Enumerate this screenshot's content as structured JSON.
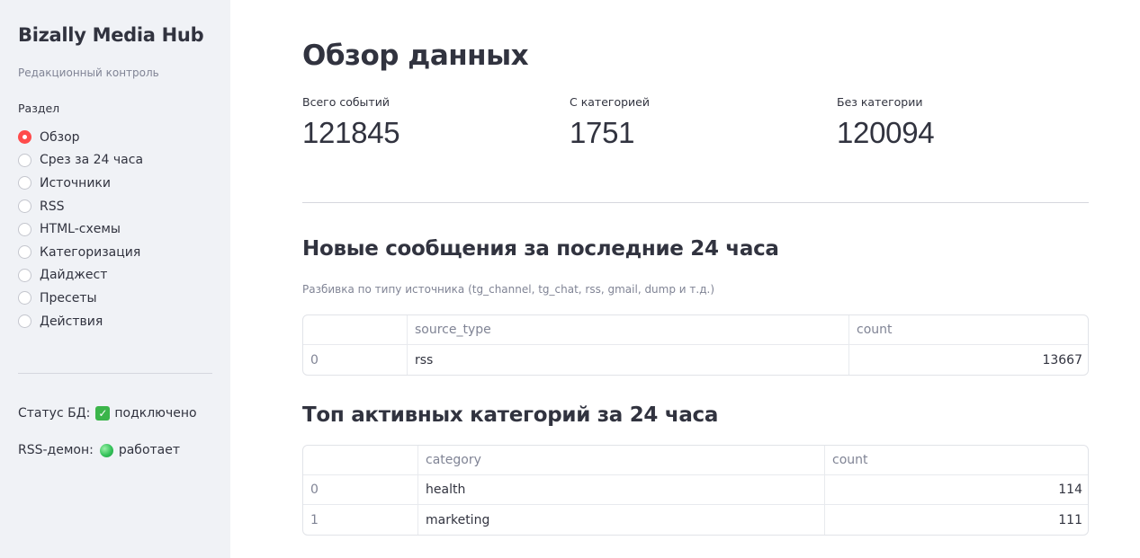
{
  "sidebar": {
    "title": "Bizally Media Hub",
    "caption": "Редакционный контроль",
    "nav_label": "Раздел",
    "items": [
      {
        "label": "Обзор",
        "selected": true
      },
      {
        "label": "Срез за 24 часа",
        "selected": false
      },
      {
        "label": "Источники",
        "selected": false
      },
      {
        "label": "RSS",
        "selected": false
      },
      {
        "label": "HTML-схемы",
        "selected": false
      },
      {
        "label": "Категоризация",
        "selected": false
      },
      {
        "label": "Дайджест",
        "selected": false
      },
      {
        "label": "Пресеты",
        "selected": false
      },
      {
        "label": "Действия",
        "selected": false
      }
    ],
    "db_status_label": "Статус БД:",
    "db_status_icon": "check-mark-icon",
    "db_status_value": "подключено",
    "rss_status_label": "RSS-демон:",
    "rss_status_icon": "green-circle-icon",
    "rss_status_value": "работает"
  },
  "main": {
    "title": "Обзор данных",
    "metrics": [
      {
        "label": "Всего событий",
        "value": "121845"
      },
      {
        "label": "С категорией",
        "value": "1751"
      },
      {
        "label": "Без категории",
        "value": "120094"
      }
    ],
    "section1": {
      "title": "Новые сообщения за последние 24 часа",
      "caption": "Разбивка по типу источника (tg_channel, tg_chat, rss, gmail, dump и т.д.)",
      "columns": [
        "",
        "source_type",
        "count"
      ],
      "rows": [
        [
          "0",
          "rss",
          "13667"
        ]
      ]
    },
    "section2": {
      "title": "Топ активных категорий за 24 часа",
      "columns": [
        "",
        "category",
        "count"
      ],
      "rows": [
        [
          "0",
          "health",
          "114"
        ],
        [
          "1",
          "marketing",
          "111"
        ]
      ]
    }
  },
  "colors": {
    "accent": "#ff4b4b",
    "sidebar_bg": "#f0f2f6",
    "text": "#31333f",
    "muted": "#808495"
  }
}
